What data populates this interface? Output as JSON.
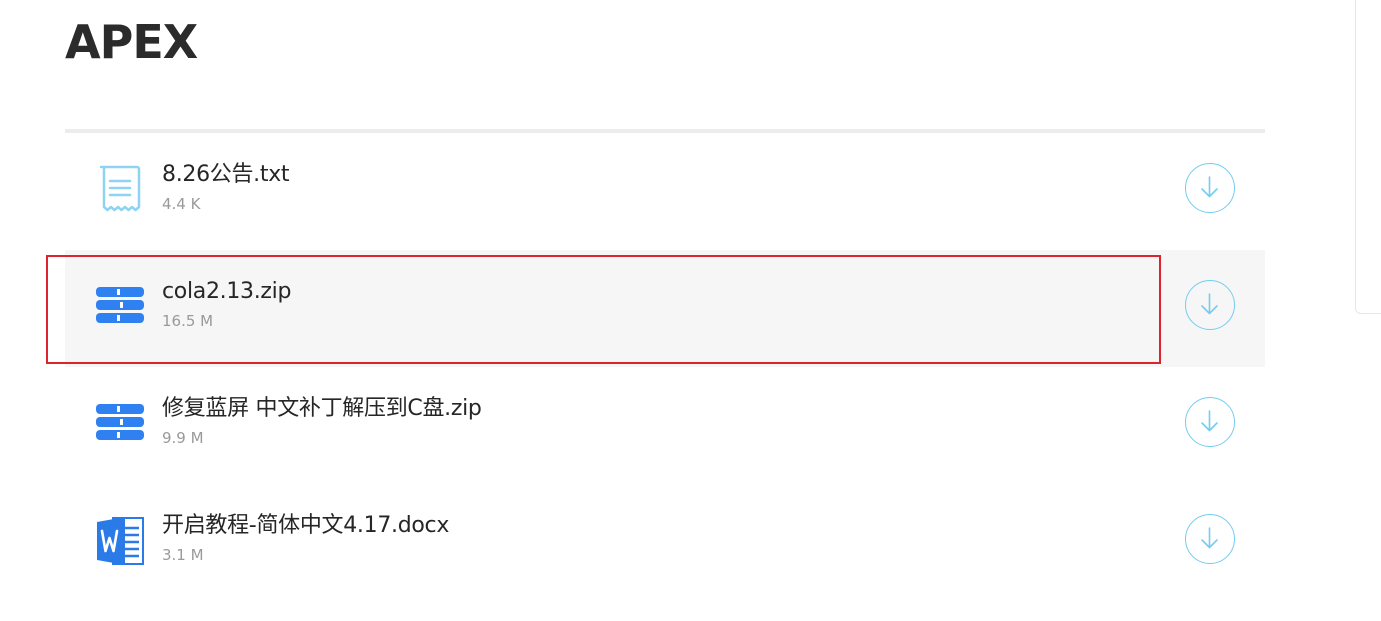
{
  "header": {
    "title": "APEX"
  },
  "files": [
    {
      "name": "8.26公告.txt",
      "size": "4.4 K",
      "icon": "text-document-icon"
    },
    {
      "name": "cola2.13.zip",
      "size": "16.5 M",
      "icon": "archive-icon"
    },
    {
      "name": "修复蓝屏 中文补丁解压到C盘.zip",
      "size": "9.9 M",
      "icon": "archive-icon"
    },
    {
      "name": "开启教程-简体中文4.17.docx",
      "size": "3.1 M",
      "icon": "word-document-icon"
    }
  ],
  "colors": {
    "accent": "#74cdf0",
    "archive_blue": "#2f80f0",
    "word_blue": "#2a7be8",
    "text_icon": "#8fd3f4",
    "selection": "#d9262c",
    "row_hover": "#f6f6f6"
  }
}
